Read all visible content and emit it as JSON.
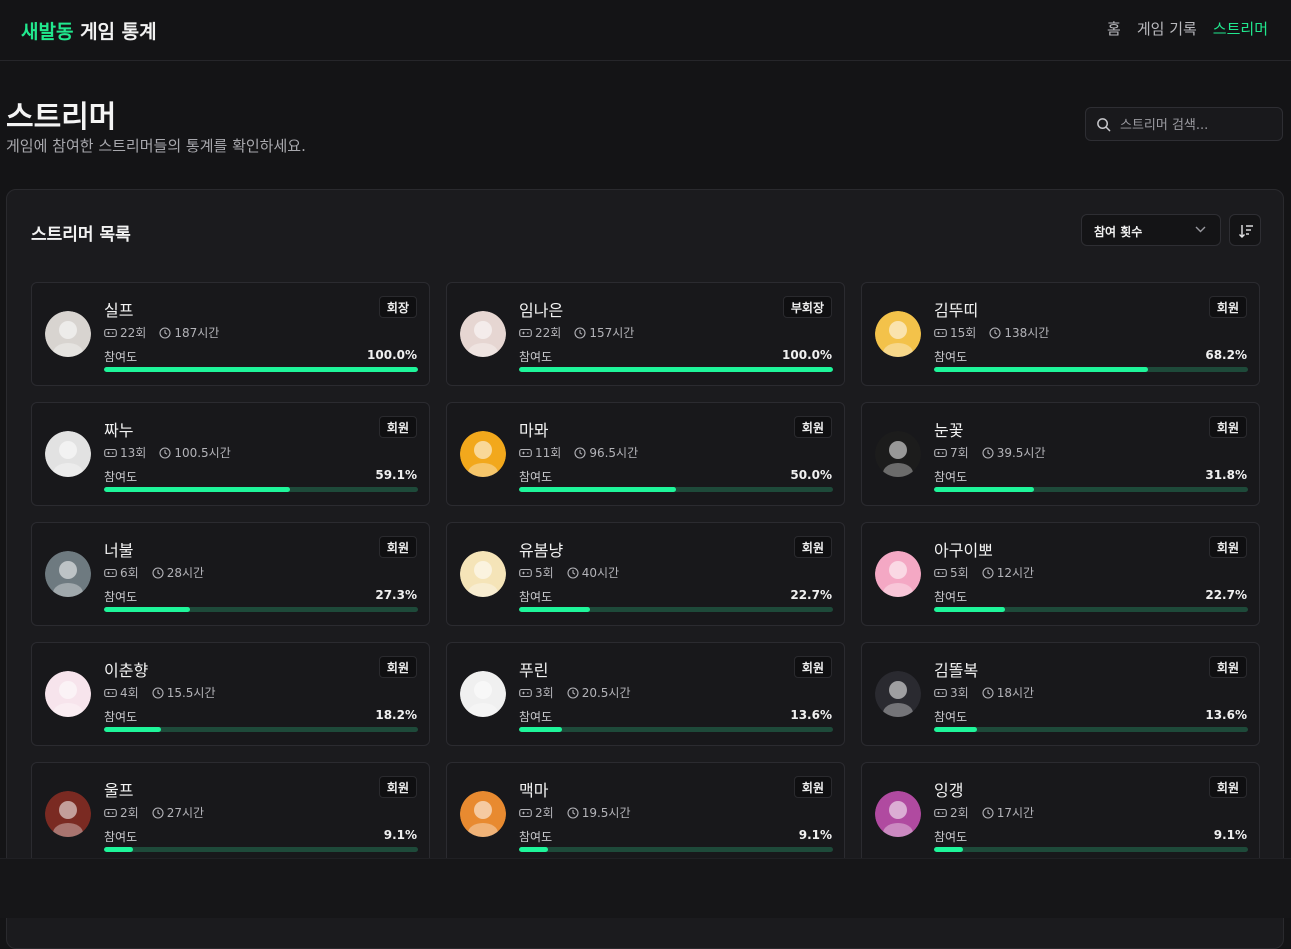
{
  "brand": {
    "accent": "새발동",
    "rest": "게임 통계"
  },
  "nav": [
    {
      "label": "홈",
      "active": false
    },
    {
      "label": "게임 기록",
      "active": false
    },
    {
      "label": "스트리머",
      "active": true
    }
  ],
  "page": {
    "title": "스트리머",
    "subtitle": "게임에 참여한 스트리머들의 통계를 확인하세요."
  },
  "search": {
    "placeholder": "스트리머 검색..."
  },
  "panel": {
    "title": "스트리머 목록",
    "sort_value": "참여 횟수"
  },
  "progress_label": "참여도",
  "colors": {
    "accent": "#21e88e",
    "bar_fill": "#1ef59a",
    "bar_track": "#1e4a3a"
  },
  "streamers": [
    {
      "name": "실프",
      "role": "회장",
      "games": "22회",
      "hours": "187시간",
      "pct_text": "100.0%",
      "pct": 100.0,
      "avatar_color": "#d8d4d0"
    },
    {
      "name": "임나은",
      "role": "부회장",
      "games": "22회",
      "hours": "157시간",
      "pct_text": "100.0%",
      "pct": 100.0,
      "avatar_color": "#e6d6d2"
    },
    {
      "name": "김뚜띠",
      "role": "회원",
      "games": "15회",
      "hours": "138시간",
      "pct_text": "68.2%",
      "pct": 68.2,
      "avatar_color": "#f3c24a"
    },
    {
      "name": "짜누",
      "role": "회원",
      "games": "13회",
      "hours": "100.5시간",
      "pct_text": "59.1%",
      "pct": 59.1,
      "avatar_color": "#e2e2e2"
    },
    {
      "name": "마뫄",
      "role": "회원",
      "games": "11회",
      "hours": "96.5시간",
      "pct_text": "50.0%",
      "pct": 50.0,
      "avatar_color": "#f2a81c"
    },
    {
      "name": "눈꽃",
      "role": "회원",
      "games": "7회",
      "hours": "39.5시간",
      "pct_text": "31.8%",
      "pct": 31.8,
      "avatar_color": "#1c1c1c"
    },
    {
      "name": "너불",
      "role": "회원",
      "games": "6회",
      "hours": "28시간",
      "pct_text": "27.3%",
      "pct": 27.3,
      "avatar_color": "#6e7a80"
    },
    {
      "name": "유봄냥",
      "role": "회원",
      "games": "5회",
      "hours": "40시간",
      "pct_text": "22.7%",
      "pct": 22.7,
      "avatar_color": "#f5e4b8"
    },
    {
      "name": "아구이뽀",
      "role": "회원",
      "games": "5회",
      "hours": "12시간",
      "pct_text": "22.7%",
      "pct": 22.7,
      "avatar_color": "#f4a8c4"
    },
    {
      "name": "이춘향",
      "role": "회원",
      "games": "4회",
      "hours": "15.5시간",
      "pct_text": "18.2%",
      "pct": 18.2,
      "avatar_color": "#f7e4ec"
    },
    {
      "name": "푸린",
      "role": "회원",
      "games": "3회",
      "hours": "20.5시간",
      "pct_text": "13.6%",
      "pct": 13.6,
      "avatar_color": "#f0f0f0"
    },
    {
      "name": "김똘복",
      "role": "회원",
      "games": "3회",
      "hours": "18시간",
      "pct_text": "13.6%",
      "pct": 13.6,
      "avatar_color": "#2a2a30"
    },
    {
      "name": "울프",
      "role": "회원",
      "games": "2회",
      "hours": "27시간",
      "pct_text": "9.1%",
      "pct": 9.1,
      "avatar_color": "#7a2a22"
    },
    {
      "name": "맥마",
      "role": "회원",
      "games": "2회",
      "hours": "19.5시간",
      "pct_text": "9.1%",
      "pct": 9.1,
      "avatar_color": "#e88a30"
    },
    {
      "name": "잉갱",
      "role": "회원",
      "games": "2회",
      "hours": "17시간",
      "pct_text": "9.1%",
      "pct": 9.1,
      "avatar_color": "#b04aa0"
    }
  ]
}
